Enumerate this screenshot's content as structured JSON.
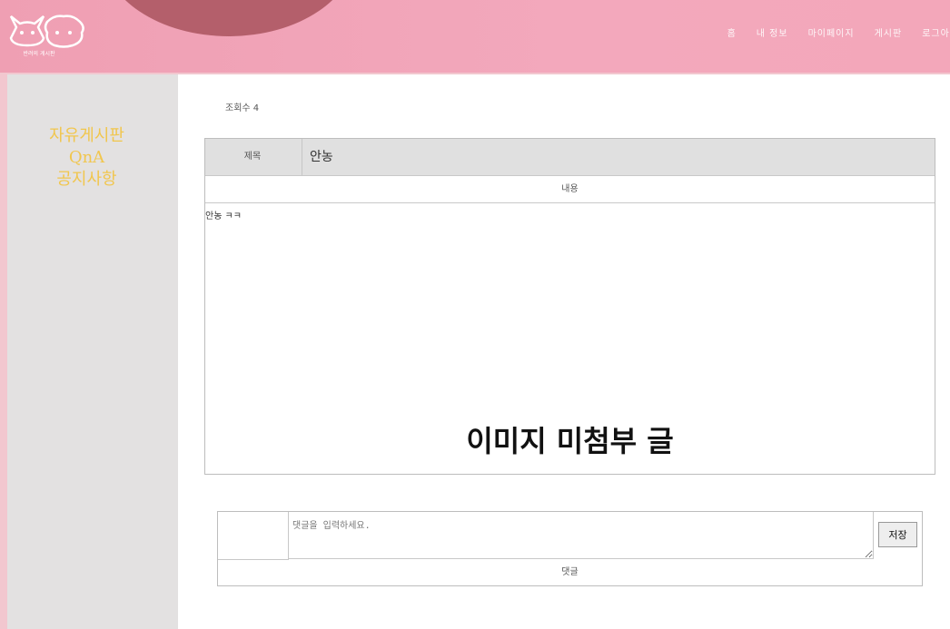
{
  "header": {
    "logo_caption": "반려의 게시판",
    "nav": [
      "홈",
      "내 정보",
      "마이페이지",
      "게시판",
      "로그아웃"
    ]
  },
  "sidebar": {
    "items": [
      "자유게시판",
      "QnA",
      "공지사항"
    ]
  },
  "post": {
    "views_text": "조회수 4",
    "title_label": "제목",
    "title_value": "안농",
    "content_header": "내용",
    "content_text": "안농 ㅋㅋ",
    "no_image_label": "이미지 미첨부 글"
  },
  "comment": {
    "placeholder": "댓글을 입력하세요.",
    "save_label": "저장",
    "footer_label": "댓글"
  },
  "colors": {
    "header": "#f3a8bc",
    "accent": "#b45f6b",
    "sidebar_link": "#f1c64d"
  }
}
